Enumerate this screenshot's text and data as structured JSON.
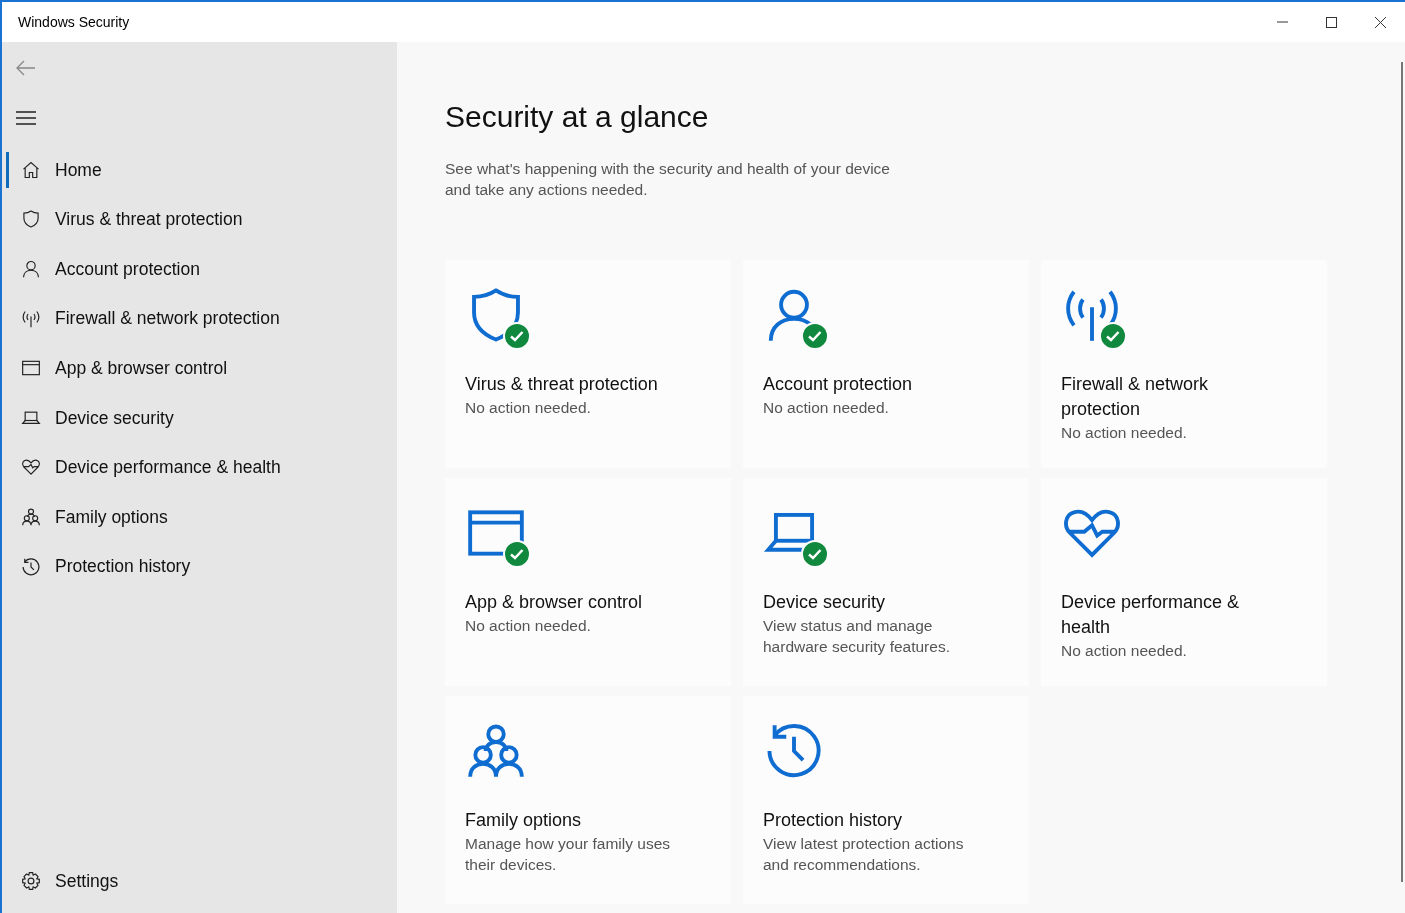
{
  "window": {
    "title": "Windows Security"
  },
  "nav": [
    {
      "label": "Home",
      "kind": "home",
      "selected": true
    },
    {
      "label": "Virus & threat protection",
      "kind": "shield",
      "selected": false
    },
    {
      "label": "Account protection",
      "kind": "person",
      "selected": false
    },
    {
      "label": "Firewall & network protection",
      "kind": "antenna",
      "selected": false
    },
    {
      "label": "App & browser control",
      "kind": "window",
      "selected": false
    },
    {
      "label": "Device security",
      "kind": "laptop",
      "selected": false
    },
    {
      "label": "Device performance & health",
      "kind": "heart",
      "selected": false
    },
    {
      "label": "Family options",
      "kind": "family",
      "selected": false
    },
    {
      "label": "Protection history",
      "kind": "history",
      "selected": false
    }
  ],
  "settings": {
    "label": "Settings"
  },
  "page": {
    "heading": "Security at a glance",
    "subtitle": "See what's happening with the security and health of your device and take any actions needed."
  },
  "cards": [
    {
      "title": "Virus & threat protection",
      "status": "No action needed.",
      "kind": "shield",
      "ok": true
    },
    {
      "title": "Account protection",
      "status": "No action needed.",
      "kind": "person",
      "ok": true
    },
    {
      "title": "Firewall & network protection",
      "status": "No action needed.",
      "kind": "antenna",
      "ok": true
    },
    {
      "title": "App & browser control",
      "status": "No action needed.",
      "kind": "window",
      "ok": true
    },
    {
      "title": "Device security",
      "status": "View status and manage hardware security features.",
      "kind": "laptop",
      "ok": true
    },
    {
      "title": "Device performance & health",
      "status": "No action needed.",
      "kind": "heart",
      "ok": false
    },
    {
      "title": "Family options",
      "status": "Manage how your family uses their devices.",
      "kind": "family",
      "ok": false
    },
    {
      "title": "Protection history",
      "status": "View latest protection actions and recommendations.",
      "kind": "history",
      "ok": false
    }
  ]
}
